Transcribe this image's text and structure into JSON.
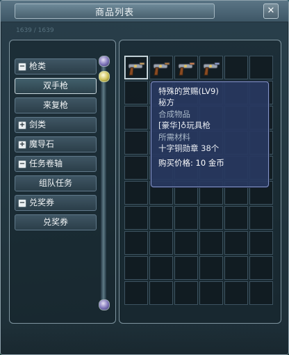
{
  "window": {
    "title": "商品列表",
    "close_label": "✕",
    "faint_text": "1639 / 1639"
  },
  "categories": [
    {
      "label": "枪类",
      "toggle": "−",
      "kind": "parent"
    },
    {
      "label": "双手枪",
      "kind": "child",
      "selected": true
    },
    {
      "label": "来复枪",
      "kind": "child"
    },
    {
      "label": "剑类",
      "toggle": "+",
      "kind": "parent"
    },
    {
      "label": "魔导石",
      "toggle": "+",
      "kind": "parent"
    },
    {
      "label": "任务卷轴",
      "toggle": "−",
      "kind": "parent"
    },
    {
      "label": "组队任务",
      "kind": "child"
    },
    {
      "label": "兑奖券",
      "toggle": "−",
      "kind": "parent"
    },
    {
      "label": "兑奖券",
      "kind": "child"
    }
  ],
  "grid": {
    "rows": 10,
    "cols": 6,
    "items": [
      "gun-icon",
      "gun-icon",
      "gun-icon",
      "gun-icon"
    ],
    "selected_index": 0
  },
  "tooltip": {
    "name": "特殊的赏赐(LV9)",
    "type": "秘方",
    "compose_label": "合成物品",
    "compose_value": "[豪华]♁玩具枪",
    "material_label": "所需材料",
    "material_value": "十字铜勋章 38个",
    "price": "购买价格: 10 金币"
  }
}
